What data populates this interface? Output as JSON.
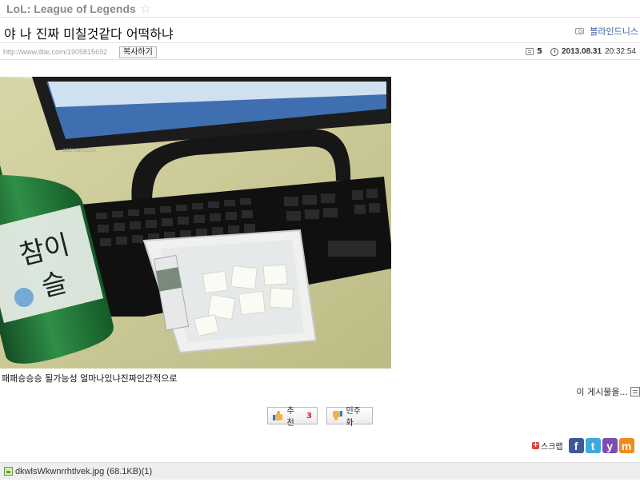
{
  "board": {
    "name": "LoL: League of Legends"
  },
  "post": {
    "title": "야 나 진짜 미칠것같다 어떡하냐",
    "author": "블라인드니스",
    "url": "http://www.ilbe.com/1905815692",
    "copy_label": "복사하기",
    "comment_count": "5",
    "date": "2013.08.31",
    "time": "20:32:54",
    "caption": "패패승승승 될가능성 얼마나있냐진짜인간적으로",
    "more_posts": "이 게시물을..."
  },
  "photo": {
    "bottle_text_1": "참이",
    "bottle_text_2": "슬",
    "monitor_brand": "JOOYONTECH"
  },
  "votes": {
    "up_label": "추천",
    "up_count": "3",
    "down_label": "민주화"
  },
  "share": {
    "scrap_label": "스크랩",
    "facebook": "f",
    "twitter": "t",
    "yozm": "y",
    "me2day": "m"
  },
  "attachment": {
    "file": "dkwlsWkwnrrhtlvek.jpg (68.1KB)(1)"
  },
  "colors": {
    "accent_link": "#3a5fa0",
    "vote_count": "#d0202a",
    "bottle_green": "#1f7a3a",
    "desk": "#c9c78f"
  }
}
